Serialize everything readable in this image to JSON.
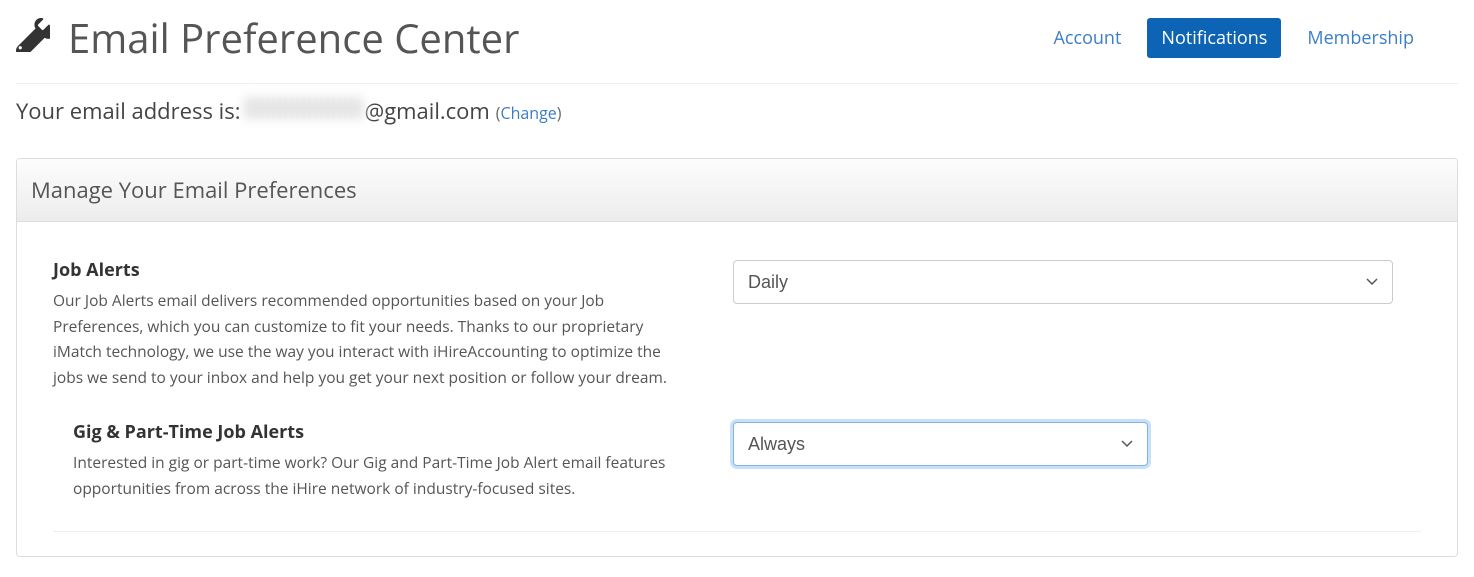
{
  "page_title": "Email Preference Center",
  "tabs": {
    "account": "Account",
    "notifications": "Notifications",
    "membership": "Membership"
  },
  "email_line": {
    "prefix": "Your email address is: ",
    "domain": "@gmail.com",
    "change_label": "Change"
  },
  "panel": {
    "header": "Manage Your Email Preferences"
  },
  "prefs": {
    "job_alerts": {
      "title": "Job Alerts",
      "desc": "Our Job Alerts email delivers recommended opportunities based on your Job Preferences, which you can customize to fit your needs. Thanks to our proprietary iMatch technology, we use the way you interact with iHireAccounting to optimize the jobs we send to your inbox and help you get your next position or follow your dream.",
      "selected": "Daily"
    },
    "gig_alerts": {
      "title": "Gig & Part-Time Job Alerts",
      "desc": "Interested in gig or part-time work? Our Gig and Part-Time Job Alert email features opportunities from across the iHire network of industry-focused sites.",
      "selected": "Always"
    }
  }
}
